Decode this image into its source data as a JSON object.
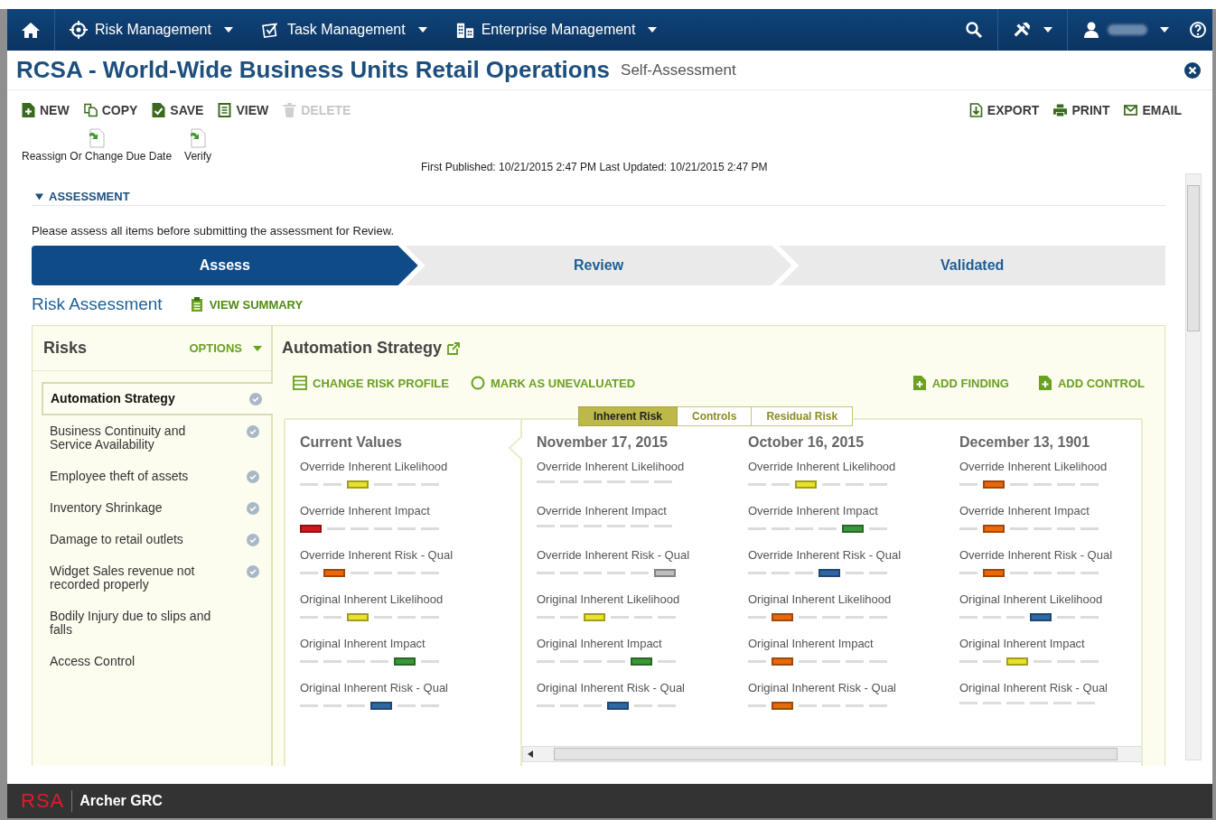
{
  "nav": {
    "items": [
      {
        "label": "Risk Management",
        "kind": "risk"
      },
      {
        "label": "Task Management",
        "kind": "task"
      },
      {
        "label": "Enterprise Management",
        "kind": "enterprise"
      }
    ]
  },
  "header": {
    "title": "RCSA - World-Wide Business Units Retail Operations",
    "subtitle": "Self-Assessment"
  },
  "toolbar": {
    "left": [
      {
        "label": "NEW",
        "kind": "new",
        "disabled": false
      },
      {
        "label": "COPY",
        "kind": "copy",
        "disabled": false
      },
      {
        "label": "SAVE",
        "kind": "save",
        "disabled": false
      },
      {
        "label": "VIEW",
        "kind": "view",
        "disabled": false
      },
      {
        "label": "DELETE",
        "kind": "delete",
        "disabled": true
      }
    ],
    "right": [
      {
        "label": "EXPORT",
        "kind": "export"
      },
      {
        "label": "PRINT",
        "kind": "print"
      },
      {
        "label": "EMAIL",
        "kind": "email"
      }
    ]
  },
  "actions": [
    {
      "label": "Reassign Or Change Due Date"
    },
    {
      "label": "Verify"
    }
  ],
  "published": "First Published: 10/21/2015 2:47 PM Last Updated: 10/21/2015 2:47 PM",
  "section": {
    "title": "ASSESSMENT",
    "expanded": true
  },
  "instruction": "Please assess all items before submitting the assessment for Review.",
  "steps": [
    {
      "label": "Assess",
      "selected": true
    },
    {
      "label": "Review",
      "selected": false
    },
    {
      "label": "Validated",
      "selected": false
    }
  ],
  "risk_assessment": {
    "title": "Risk Assessment",
    "view_summary": "VIEW SUMMARY"
  },
  "risks": {
    "title": "Risks",
    "options": "OPTIONS",
    "items": [
      {
        "label": "Automation Strategy",
        "selected": true,
        "completed": true
      },
      {
        "label": "Business Continuity and Service Availability",
        "selected": false,
        "completed": true
      },
      {
        "label": "Employee theft of assets",
        "selected": false,
        "completed": true
      },
      {
        "label": "Inventory Shrinkage",
        "selected": false,
        "completed": true
      },
      {
        "label": "Damage to retail outlets",
        "selected": false,
        "completed": true
      },
      {
        "label": "Widget Sales revenue not recorded properly",
        "selected": false,
        "completed": true
      },
      {
        "label": "Bodily Injury due to slips and falls",
        "selected": false,
        "completed": false
      },
      {
        "label": "Access Control",
        "selected": false,
        "completed": false
      }
    ]
  },
  "detail": {
    "title": "Automation Strategy",
    "actions": [
      {
        "label": "CHANGE RISK PROFILE",
        "kind": "profile"
      },
      {
        "label": "MARK AS UNEVALUATED",
        "kind": "unevaluated"
      }
    ],
    "add_actions": [
      {
        "label": "ADD FINDING"
      },
      {
        "label": "ADD CONTROL"
      }
    ],
    "tabs": [
      {
        "label": "Inherent Risk",
        "selected": true
      },
      {
        "label": "Controls",
        "selected": false
      },
      {
        "label": "Residual Risk",
        "selected": false
      }
    ],
    "columns": [
      {
        "heading": "Current Values",
        "ratings": [
          {
            "label": "Override Inherent Likelihood",
            "slots": [
              {
                "selected": false
              },
              {
                "selected": false
              },
              {
                "selected": true,
                "color": "#e8e229"
              },
              {
                "selected": false
              },
              {
                "selected": false
              },
              {
                "selected": false
              }
            ]
          },
          {
            "label": "Override Inherent Impact",
            "slots": [
              {
                "selected": true,
                "color": "#cc1b1b"
              },
              {
                "selected": false
              },
              {
                "selected": false
              },
              {
                "selected": false
              },
              {
                "selected": false
              },
              {
                "selected": false
              }
            ]
          },
          {
            "label": "Override Inherent Risk - Qual",
            "slots": [
              {
                "selected": false
              },
              {
                "selected": true,
                "color": "#e8680c"
              },
              {
                "selected": false
              },
              {
                "selected": false
              },
              {
                "selected": false
              },
              {
                "selected": false
              }
            ]
          },
          {
            "label": "Original Inherent Likelihood",
            "slots": [
              {
                "selected": false
              },
              {
                "selected": false
              },
              {
                "selected": true,
                "color": "#e8e229"
              },
              {
                "selected": false
              },
              {
                "selected": false
              },
              {
                "selected": false
              }
            ]
          },
          {
            "label": "Original Inherent Impact",
            "slots": [
              {
                "selected": false
              },
              {
                "selected": false
              },
              {
                "selected": false
              },
              {
                "selected": false
              },
              {
                "selected": true,
                "color": "#3a9636"
              },
              {
                "selected": false
              }
            ]
          },
          {
            "label": "Original Inherent Risk - Qual",
            "slots": [
              {
                "selected": false
              },
              {
                "selected": false
              },
              {
                "selected": false
              },
              {
                "selected": true,
                "color": "#2e67a3"
              },
              {
                "selected": false
              },
              {
                "selected": false
              }
            ]
          }
        ]
      },
      {
        "heading": "November 17, 2015",
        "ratings": [
          {
            "label": "Override Inherent Likelihood",
            "slots": [
              {
                "selected": false
              },
              {
                "selected": false
              },
              {
                "selected": false
              },
              {
                "selected": false
              },
              {
                "selected": false
              },
              {
                "selected": false
              }
            ]
          },
          {
            "label": "Override Inherent Impact",
            "slots": [
              {
                "selected": false
              },
              {
                "selected": false
              },
              {
                "selected": false
              },
              {
                "selected": false
              },
              {
                "selected": false
              },
              {
                "selected": false
              }
            ]
          },
          {
            "label": "Override Inherent Risk - Qual",
            "slots": [
              {
                "selected": false
              },
              {
                "selected": false
              },
              {
                "selected": false
              },
              {
                "selected": false
              },
              {
                "selected": false
              },
              {
                "selected": true,
                "color": "#bdbdbd"
              }
            ]
          },
          {
            "label": "Original Inherent Likelihood",
            "slots": [
              {
                "selected": false
              },
              {
                "selected": false
              },
              {
                "selected": true,
                "color": "#e8e229"
              },
              {
                "selected": false
              },
              {
                "selected": false
              },
              {
                "selected": false
              }
            ]
          },
          {
            "label": "Original Inherent Impact",
            "slots": [
              {
                "selected": false
              },
              {
                "selected": false
              },
              {
                "selected": false
              },
              {
                "selected": false
              },
              {
                "selected": true,
                "color": "#3a9636"
              },
              {
                "selected": false
              }
            ]
          },
          {
            "label": "Original Inherent Risk - Qual",
            "slots": [
              {
                "selected": false
              },
              {
                "selected": false
              },
              {
                "selected": false
              },
              {
                "selected": true,
                "color": "#2e67a3"
              },
              {
                "selected": false
              },
              {
                "selected": false
              }
            ]
          }
        ]
      },
      {
        "heading": "October 16, 2015",
        "ratings": [
          {
            "label": "Override Inherent Likelihood",
            "slots": [
              {
                "selected": false
              },
              {
                "selected": false
              },
              {
                "selected": true,
                "color": "#e8e229"
              },
              {
                "selected": false
              },
              {
                "selected": false
              },
              {
                "selected": false
              }
            ]
          },
          {
            "label": "Override Inherent Impact",
            "slots": [
              {
                "selected": false
              },
              {
                "selected": false
              },
              {
                "selected": false
              },
              {
                "selected": false
              },
              {
                "selected": true,
                "color": "#3a9636"
              },
              {
                "selected": false
              }
            ]
          },
          {
            "label": "Override Inherent Risk - Qual",
            "slots": [
              {
                "selected": false
              },
              {
                "selected": false
              },
              {
                "selected": false
              },
              {
                "selected": true,
                "color": "#2e67a3"
              },
              {
                "selected": false
              },
              {
                "selected": false
              }
            ]
          },
          {
            "label": "Original Inherent Likelihood",
            "slots": [
              {
                "selected": false
              },
              {
                "selected": true,
                "color": "#e8680c"
              },
              {
                "selected": false
              },
              {
                "selected": false
              },
              {
                "selected": false
              },
              {
                "selected": false
              }
            ]
          },
          {
            "label": "Original Inherent Impact",
            "slots": [
              {
                "selected": false
              },
              {
                "selected": true,
                "color": "#e8680c"
              },
              {
                "selected": false
              },
              {
                "selected": false
              },
              {
                "selected": false
              },
              {
                "selected": false
              }
            ]
          },
          {
            "label": "Original Inherent Risk - Qual",
            "slots": [
              {
                "selected": false
              },
              {
                "selected": true,
                "color": "#e8680c"
              },
              {
                "selected": false
              },
              {
                "selected": false
              },
              {
                "selected": false
              },
              {
                "selected": false
              }
            ]
          }
        ]
      },
      {
        "heading": "December 13, 1901",
        "ratings": [
          {
            "label": "Override Inherent Likelihood",
            "slots": [
              {
                "selected": false
              },
              {
                "selected": true,
                "color": "#e8680c"
              },
              {
                "selected": false
              },
              {
                "selected": false
              },
              {
                "selected": false
              },
              {
                "selected": false
              }
            ]
          },
          {
            "label": "Override Inherent Impact",
            "slots": [
              {
                "selected": false
              },
              {
                "selected": true,
                "color": "#e8680c"
              },
              {
                "selected": false
              },
              {
                "selected": false
              },
              {
                "selected": false
              },
              {
                "selected": false
              }
            ]
          },
          {
            "label": "Override Inherent Risk - Qual",
            "slots": [
              {
                "selected": false
              },
              {
                "selected": true,
                "color": "#e8680c"
              },
              {
                "selected": false
              },
              {
                "selected": false
              },
              {
                "selected": false
              },
              {
                "selected": false
              }
            ]
          },
          {
            "label": "Original Inherent Likelihood",
            "slots": [
              {
                "selected": false
              },
              {
                "selected": false
              },
              {
                "selected": false
              },
              {
                "selected": true,
                "color": "#2e67a3"
              },
              {
                "selected": false
              },
              {
                "selected": false
              }
            ]
          },
          {
            "label": "Original Inherent Impact",
            "slots": [
              {
                "selected": false
              },
              {
                "selected": false
              },
              {
                "selected": true,
                "color": "#e8e229"
              },
              {
                "selected": false
              },
              {
                "selected": false
              },
              {
                "selected": false
              }
            ]
          },
          {
            "label": "Original Inherent Risk - Qual",
            "slots": [
              {
                "selected": false
              },
              {
                "selected": false
              },
              {
                "selected": false
              },
              {
                "selected": false
              },
              {
                "selected": false
              },
              {
                "selected": false
              }
            ]
          }
        ]
      }
    ]
  },
  "footer": {
    "brand": "RSA",
    "product": "Archer GRC"
  }
}
